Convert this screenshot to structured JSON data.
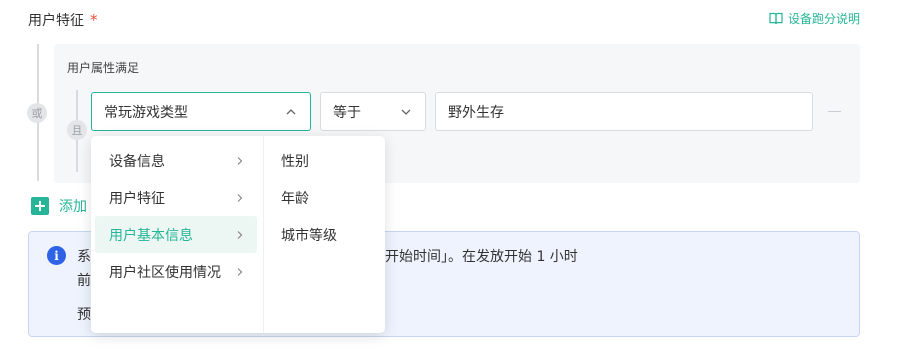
{
  "field": {
    "label": "用户特征",
    "required": "*"
  },
  "help_link": {
    "label": "设备跑分说明"
  },
  "outer_group": {
    "badge": "或"
  },
  "inner_group": {
    "title": "用户属性满足",
    "badge": "且"
  },
  "condition": {
    "attribute": "常玩游戏类型",
    "operator": "等于",
    "value": "野外生存"
  },
  "add": {
    "label": "添加"
  },
  "notice": {
    "text_line1": "系统将通过短信通知，发送时间为您设置的「发放开始时间」。在发放开始 1 小时",
    "text_line2": "前",
    "text_line3": "预"
  },
  "cascader": {
    "level1": [
      {
        "label": "设备信息"
      },
      {
        "label": "用户特征"
      },
      {
        "label": "用户基本信息",
        "selected": true
      },
      {
        "label": "用户社区使用情况"
      }
    ],
    "level2": [
      {
        "label": "性别"
      },
      {
        "label": "年龄"
      },
      {
        "label": "城市等级"
      }
    ]
  },
  "colors": {
    "accent": "#26b598",
    "required": "#e74c3c",
    "info": "#2e63e6",
    "notice_bg": "#eef3fd"
  }
}
